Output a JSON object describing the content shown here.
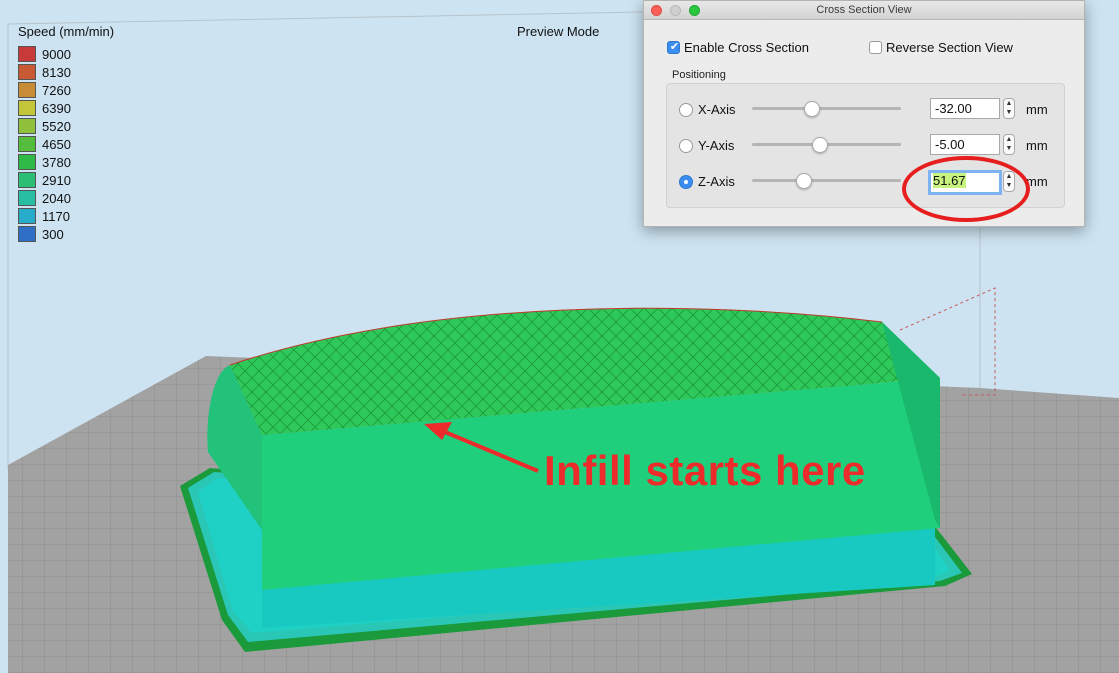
{
  "legend": {
    "title": "Speed (mm/min)",
    "entries": [
      {
        "label": "9000",
        "color": "#c8393a"
      },
      {
        "label": "8130",
        "color": "#c75a35"
      },
      {
        "label": "7260",
        "color": "#c78c35"
      },
      {
        "label": "6390",
        "color": "#c3c638"
      },
      {
        "label": "5520",
        "color": "#8fc13c"
      },
      {
        "label": "4650",
        "color": "#54be3c"
      },
      {
        "label": "3780",
        "color": "#2fba47"
      },
      {
        "label": "2910",
        "color": "#2bbf76"
      },
      {
        "label": "2040",
        "color": "#27bea4"
      },
      {
        "label": "1170",
        "color": "#28abc8"
      },
      {
        "label": "300",
        "color": "#2f6fc6"
      }
    ]
  },
  "mode_label": "Preview Mode",
  "annotation": {
    "text": "Infill starts here",
    "color": "#ee2b2b"
  },
  "dialog": {
    "title": "Cross Section View",
    "enable_cross_section": {
      "label": "Enable Cross Section",
      "checked": true
    },
    "reverse_section_view": {
      "label": "Reverse Section View",
      "checked": false
    },
    "positioning_label": "Positioning",
    "axes": [
      {
        "label": "X-Axis",
        "value": "-32.00",
        "unit": "mm",
        "selected": false
      },
      {
        "label": "Y-Axis",
        "value": "-5.00",
        "unit": "mm",
        "selected": false
      },
      {
        "label": "Z-Axis",
        "value": "51.67",
        "unit": "mm",
        "selected": true
      }
    ]
  },
  "colors": {
    "background": "#cde3f1",
    "build_plate": "#a2a2a2",
    "model_upper": "#1fcf7c",
    "model_lower": "#18c9c2",
    "accent": "#3b8ef0",
    "highlight_ring": "#e61e1e"
  }
}
